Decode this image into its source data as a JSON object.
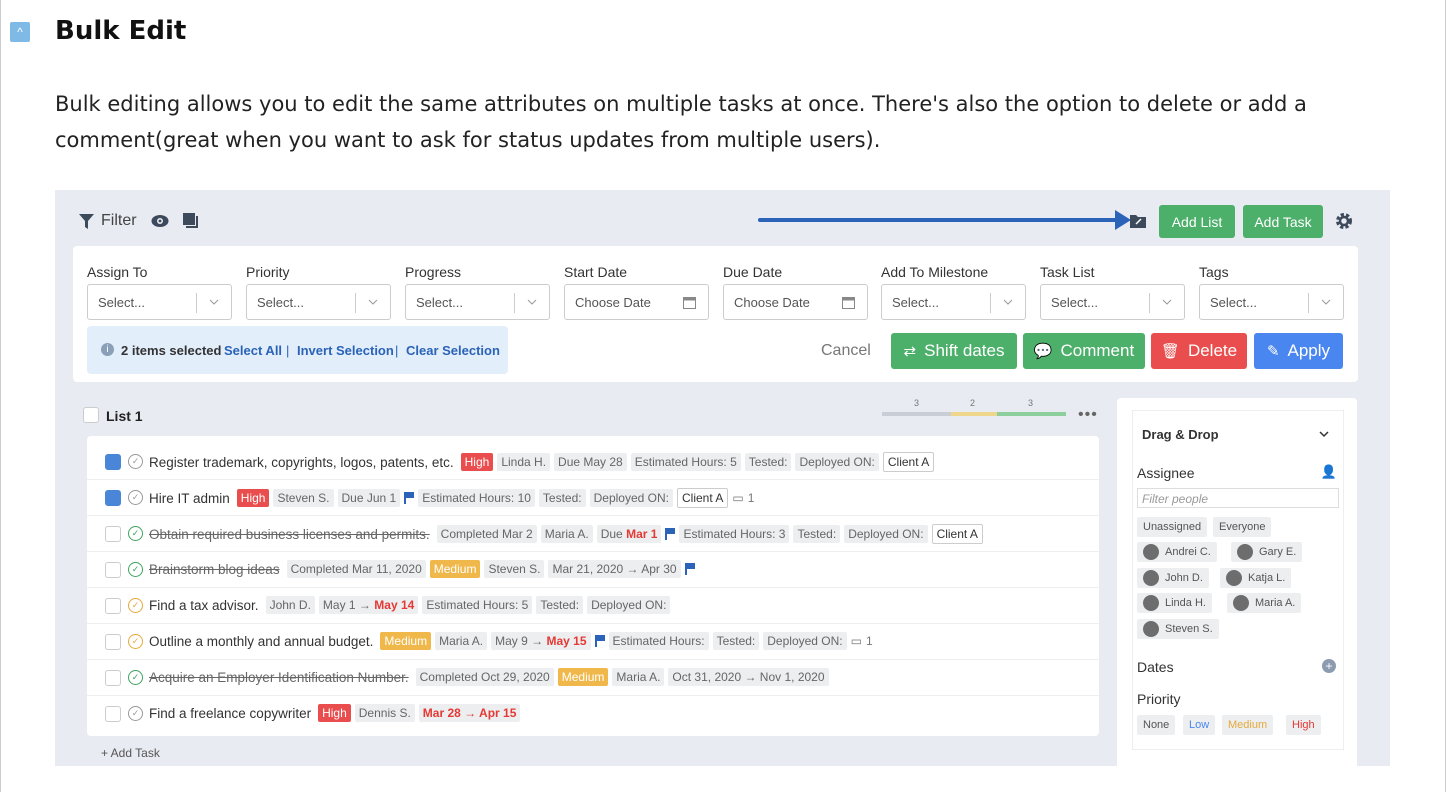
{
  "section": {
    "title": "Bulk Edit",
    "description": "Bulk editing allows you to edit the same attributes on multiple tasks at once. There's also the option to delete or add a comment(great when you want to ask for status updates from multiple users)."
  },
  "toolbar": {
    "filter_label": "Filter",
    "add_list": "Add List",
    "add_task": "Add Task"
  },
  "filters": [
    {
      "label": "Assign To",
      "value": "Select..."
    },
    {
      "label": "Priority",
      "value": "Select..."
    },
    {
      "label": "Progress",
      "value": "Select..."
    },
    {
      "label": "Start Date",
      "value": "Choose Date"
    },
    {
      "label": "Due Date",
      "value": "Choose Date"
    },
    {
      "label": "Add To Milestone",
      "value": "Select..."
    },
    {
      "label": "Task List",
      "value": "Select..."
    },
    {
      "label": "Tags",
      "value": "Select..."
    }
  ],
  "selection": {
    "count": "2 items selected",
    "select_all": "Select All",
    "sep": "|",
    "invert": "Invert Selection",
    "clear": "Clear Selection"
  },
  "actions": {
    "cancel": "Cancel",
    "shift": "Shift dates",
    "comment": "Comment",
    "delete": "Delete",
    "apply": "Apply"
  },
  "list": {
    "name": "List 1",
    "progress": [
      "3",
      "2",
      "3"
    ],
    "more": "•••",
    "add_task": "+ Add Task"
  },
  "colors": {
    "green": "#4caf6a",
    "red": "#e94d4d",
    "blue": "#4a86f0",
    "arrow": "#2a63b7"
  },
  "tasks": [
    {
      "title": "Register trademark, copyrights, logos, patents, etc.",
      "priority": "High",
      "assignee": "Linda H.",
      "due": "Due May 28",
      "hours": "Estimated Hours: 5",
      "tested": "Tested:",
      "deployed": "Deployed ON:",
      "client": "Client A"
    },
    {
      "title": "Hire IT admin",
      "priority": "High",
      "assignee": "Steven S.",
      "due": "Due Jun 1",
      "hours": "Estimated Hours: 10",
      "tested": "Tested:",
      "deployed": "Deployed ON:",
      "client": "Client A",
      "count": "1"
    },
    {
      "title": "Obtain required business licenses and permits.",
      "completed": "Completed Mar 2",
      "assignee": "Maria A.",
      "due_prefix": "Due",
      "due_red": "Mar 1",
      "hours": "Estimated Hours: 3",
      "tested": "Tested:",
      "deployed": "Deployed ON:",
      "client": "Client A"
    },
    {
      "title": "Brainstorm blog ideas",
      "completed": "Completed Mar 11, 2020",
      "priority": "Medium",
      "assignee": "Steven S.",
      "range": "Mar 21, 2020 → Apr 30"
    },
    {
      "title": "Find a tax advisor.",
      "assignee": "John D.",
      "range_start": "May 1 →",
      "range_end": "May 14",
      "hours": "Estimated Hours: 5",
      "tested": "Tested:",
      "deployed": "Deployed ON:"
    },
    {
      "title": "Outline a monthly and annual budget.",
      "priority": "Medium",
      "assignee": "Maria A.",
      "range_start": "May 9 →",
      "range_end": "May 15",
      "hours": "Estimated Hours:",
      "tested": "Tested:",
      "deployed": "Deployed ON:",
      "count": "1"
    },
    {
      "title": "Acquire an Employer Identification Number.",
      "completed": "Completed Oct 29, 2020",
      "priority": "Medium",
      "assignee": "Maria A.",
      "range": "Oct 31, 2020 → Nov 1, 2020"
    },
    {
      "title": "Find a freelance copywriter",
      "priority": "High",
      "assignee": "Dennis S.",
      "range_red": "Mar 28 → Apr 15"
    }
  ],
  "sidebar": {
    "title": "Drag & Drop",
    "assignee_label": "Assignee",
    "filter_placeholder": "Filter people",
    "groups": [
      "Unassigned",
      "Everyone"
    ],
    "people": [
      "Andrei C.",
      "Gary E.",
      "John D.",
      "Katja L.",
      "Linda H.",
      "Maria A.",
      "Steven S."
    ],
    "dates_label": "Dates",
    "priority_label": "Priority",
    "priorities": [
      "None",
      "Low",
      "Medium",
      "High"
    ]
  }
}
